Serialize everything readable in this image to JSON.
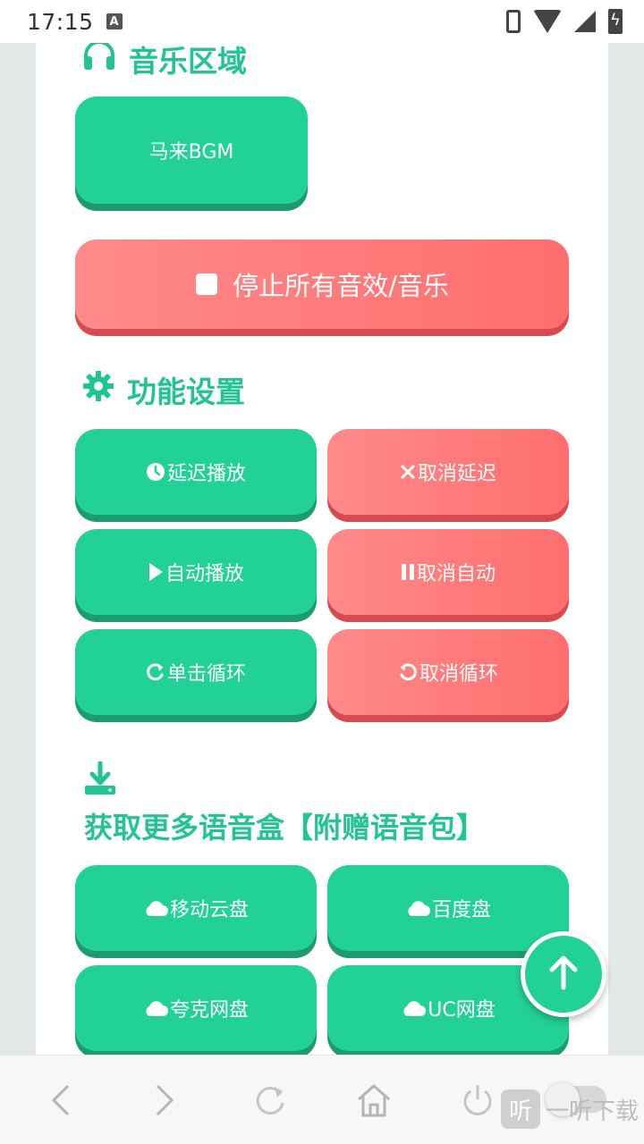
{
  "status_bar": {
    "time": "17:15",
    "badge": "A"
  },
  "music_section": {
    "title": "音乐区域",
    "icon": "headphones-icon",
    "buttons": [
      {
        "label": "马来BGM"
      }
    ],
    "stop_button": {
      "label": "停止所有音效/音乐",
      "icon": "stop-icon"
    }
  },
  "settings_section": {
    "title": "功能设置",
    "icon": "gear-icon",
    "buttons": {
      "delay_play": {
        "label": "延迟播放",
        "icon": "clock-icon"
      },
      "cancel_delay": {
        "label": "取消延迟",
        "icon": "close-icon"
      },
      "auto_play": {
        "label": "自动播放",
        "icon": "play-icon"
      },
      "cancel_auto": {
        "label": "取消自动",
        "icon": "pause-icon"
      },
      "click_loop": {
        "label": "单击循环",
        "icon": "redo-icon"
      },
      "cancel_loop": {
        "label": "取消循环",
        "icon": "undo-icon"
      }
    }
  },
  "download_section": {
    "title": "获取更多语音盒【附赠语音包】",
    "icon": "download-icon",
    "buttons": {
      "mobile_cloud": {
        "label": "移动云盘",
        "icon": "cloud-icon"
      },
      "baidu": {
        "label": "百度盘",
        "icon": "cloud-icon"
      },
      "quark": {
        "label": "夸克网盘",
        "icon": "cloud-icon"
      },
      "uc": {
        "label": "UC网盘",
        "icon": "cloud-icon"
      }
    }
  },
  "fab": {
    "icon": "arrow-up-icon"
  },
  "bottom_nav": {
    "items": [
      "back-icon",
      "forward-icon",
      "refresh-icon",
      "home-icon",
      "power-icon"
    ],
    "watermark": {
      "badge": "听",
      "text": "一听下载"
    }
  },
  "colors": {
    "accent_green": "#22d195",
    "title_green": "#22c591",
    "accent_red": "#ff7373"
  }
}
